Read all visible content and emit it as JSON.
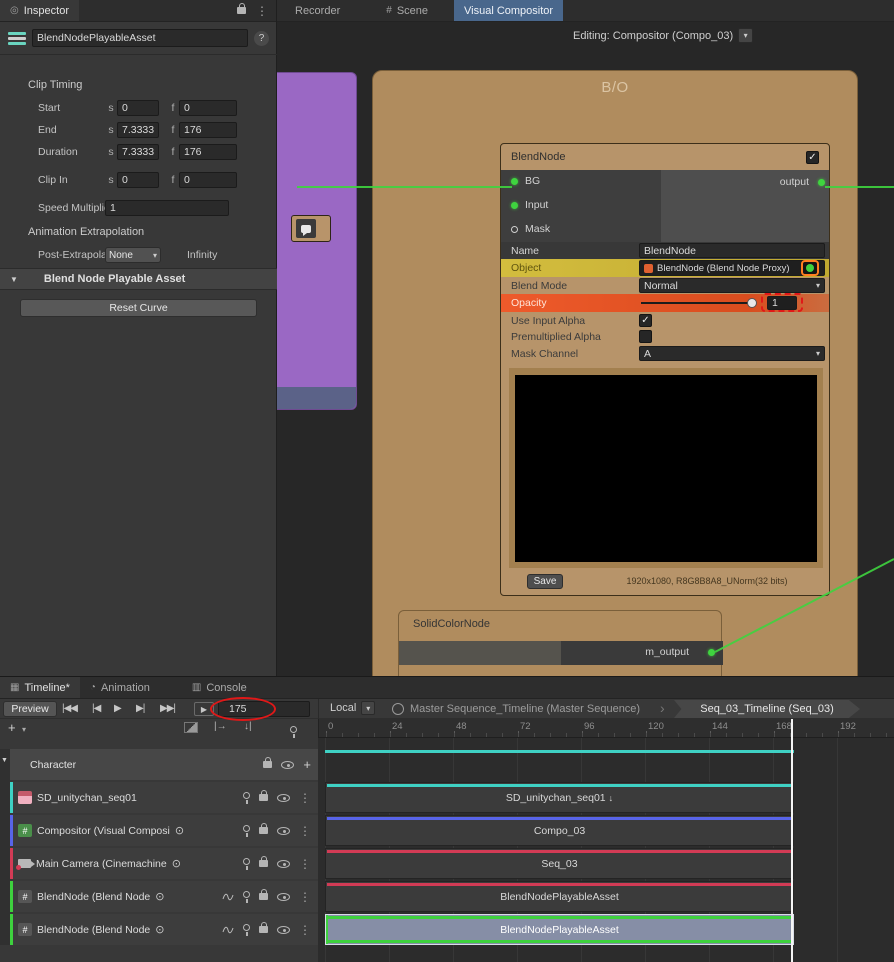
{
  "icons": {
    "kebab": "⋮",
    "caret": "▾",
    "foldout": "▼",
    "check": "✓",
    "help": "?",
    "hash": "#",
    "target": "⊙",
    "plus": "+",
    "clip_in": "↓",
    "to_start": "|◀◀",
    "step_back": "|◀",
    "play": "▶",
    "step_fwd": "▶|",
    "to_end": "▶▶|",
    "range_play": "▶",
    "inspector": "◎",
    "timeline": "▦",
    "animation": "◔",
    "console": "▥",
    "chevron": "›"
  },
  "inspector": {
    "tab_label": "Inspector",
    "asset_name": "BlendNodePlayableAsset",
    "clip_timing_title": "Clip Timing",
    "s_unit": "s",
    "f_unit": "f",
    "timing_rows": [
      {
        "label": "Start",
        "s": "0",
        "f": "0"
      },
      {
        "label": "End",
        "s": "7.3333",
        "f": "176"
      },
      {
        "label": "Duration",
        "s": "7.3333",
        "f": "176"
      },
      {
        "label": "Clip In",
        "s": "0",
        "f": "0"
      }
    ],
    "speed_label": "Speed Multiplier",
    "speed_value": "1",
    "anim_title": "Animation Extrapolation",
    "post_label": "Post-Extrapolate",
    "post_value": "None",
    "infinity_label": "Infinity",
    "foldout_title": "Blend Node Playable Asset",
    "reset_button": "Reset Curve"
  },
  "compositor": {
    "tab_recorder": "Recorder",
    "tab_scene": "Scene",
    "tab_visual": "Visual Compositor",
    "editing_label": "Editing: Compositor (Compo_03)",
    "group_title": "B/O",
    "blend": {
      "title": "BlendNode",
      "port_bg": "BG",
      "port_input": "Input",
      "port_mask": "Mask",
      "port_output": "output",
      "name_label": "Name",
      "name_value": "BlendNode",
      "object_label": "Object",
      "object_value": "BlendNode (Blend Node Proxy)",
      "blend_mode_label": "Blend Mode",
      "blend_mode_value": "Normal",
      "opacity_label": "Opacity",
      "opacity_value": "1",
      "use_input_alpha_label": "Use Input Alpha",
      "premultiplied_label": "Premultiplied Alpha",
      "mask_channel_label": "Mask Channel",
      "mask_channel_value": "A",
      "save_button": "Save",
      "format_info": "1920x1080, R8G8B8A8_UNorm(32 bits)"
    },
    "solid": {
      "title": "SolidColorNode",
      "port_output": "m_output"
    }
  },
  "timeline": {
    "tab_timeline": "Timeline*",
    "tab_animation": "Animation",
    "tab_console": "Console",
    "preview_label": "Preview",
    "frame_value": "175",
    "local_label": "Local",
    "crumb_master": "Master Sequence_Timeline (Master Sequence)",
    "crumb_current": "Seq_03_Timeline (Seq_03)",
    "tracks": [
      {
        "name": "Character"
      },
      {
        "name": "SD_unitychan_seq01"
      },
      {
        "name": "Compositor (Visual Composi"
      },
      {
        "name": "Main Camera (Cinemachine"
      },
      {
        "name": "BlendNode (Blend Node"
      },
      {
        "name": "BlendNode (Blend Node"
      }
    ],
    "ruler_labels": [
      "0",
      "24",
      "48",
      "72",
      "96",
      "120",
      "144",
      "168",
      "192"
    ],
    "clips": [
      {
        "label": "SD_unitychan_seq01"
      },
      {
        "label": "Compo_03"
      },
      {
        "label": "Seq_03"
      },
      {
        "label": "BlendNodePlayableAsset"
      },
      {
        "label": "BlendNodePlayableAsset"
      }
    ]
  },
  "colors": {
    "accent_green": "#3fd43f",
    "selection_green": "#3ed13e",
    "clip_teal": "#3fd1c4",
    "clip_blue": "#5864e8",
    "clip_red": "#d23b55",
    "node_tan": "#b08c5e",
    "node_purple": "#9a68c4",
    "highlight_yellow": "#d3bd3e",
    "highlight_orange": "#ee5a2b",
    "annotation_red": "#e01818",
    "annotation_orange": "#ff7f1f",
    "tab_blue": "#49678c"
  }
}
